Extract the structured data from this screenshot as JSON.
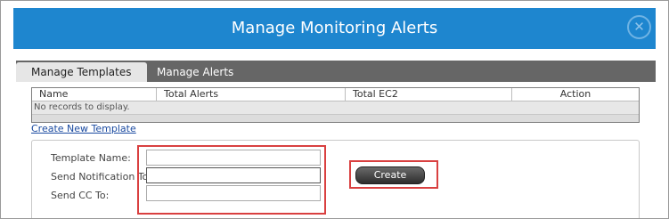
{
  "dialog": {
    "title": "Manage Monitoring Alerts",
    "close_icon": "close-icon"
  },
  "tabs": [
    {
      "label": "Manage Templates",
      "active": true
    },
    {
      "label": "Manage Alerts",
      "active": false
    }
  ],
  "grid": {
    "columns": [
      "Name",
      "Total Alerts",
      "Total EC2",
      "Action"
    ],
    "empty_message": "No records to display."
  },
  "create_link": "Create New Template",
  "form": {
    "template_name_label": "Template Name:",
    "template_name_value": "",
    "send_to_label": "Send Notification To:",
    "send_to_value": "",
    "cc_label": "Send CC To:",
    "cc_value": "",
    "create_button": "Create"
  },
  "colors": {
    "title_bar": "#1e86cf",
    "tab_bar": "#666666",
    "highlight": "#d94040"
  }
}
